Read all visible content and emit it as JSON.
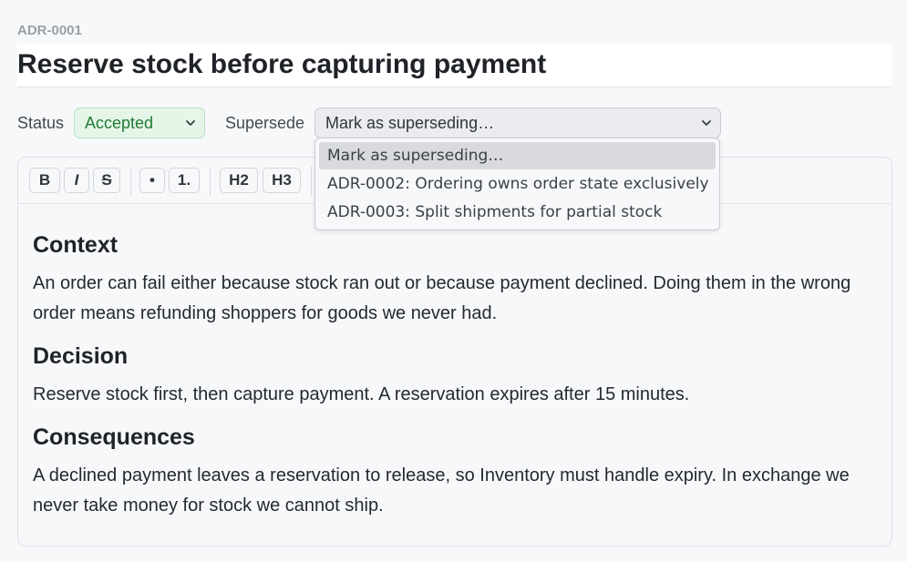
{
  "document": {
    "id": "ADR-0001",
    "title": "Reserve stock before capturing payment"
  },
  "meta": {
    "status_label": "Status",
    "status_value": "Accepted",
    "supersede_label": "Supersede",
    "supersede_value": "Mark as superseding…"
  },
  "supersede_options": [
    "Mark as superseding…",
    "ADR-0002: Ordering owns order state exclusively",
    "ADR-0003: Split shipments for partial stock"
  ],
  "toolbar": {
    "bold": "B",
    "italic": "I",
    "strike": "S",
    "bullet_list": "•",
    "ordered_list": "1.",
    "h2": "H2",
    "h3": "H3"
  },
  "content": {
    "context_heading": "Context",
    "context_text": "An order can fail either because stock ran out or because payment declined. Doing them in the wrong order means refunding shoppers for goods we never had.",
    "decision_heading": "Decision",
    "decision_text": "Reserve stock first, then capture payment. A reservation expires after 15 minutes.",
    "consequences_heading": "Consequences",
    "consequences_text": "A declined payment leaves a reservation to release, so Inventory must handle expiry. In exchange we never take money for stock we cannot ship."
  },
  "colors": {
    "status_accent": "#1f7a35",
    "status_background": "#e5f6e8",
    "page_background": "#f7f8fa"
  },
  "icons": {
    "select_arrow": "chevron-down-icon"
  }
}
